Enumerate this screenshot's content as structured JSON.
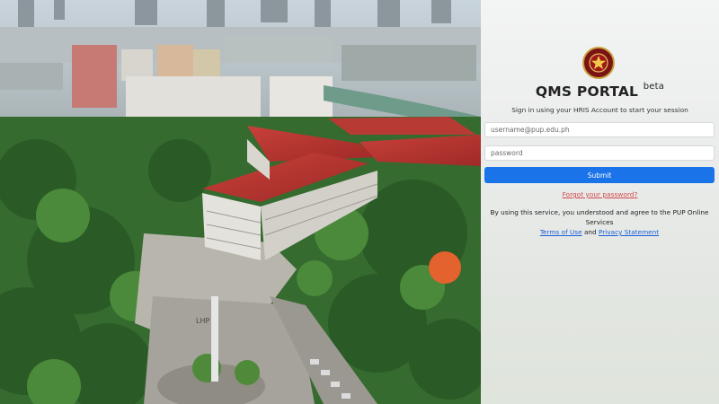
{
  "background": {
    "description_icon": "campus-aerial-photo",
    "sign_text": "LHP"
  },
  "login": {
    "logo_icon": "pup-seal-icon",
    "title": "QMS PORTAL",
    "title_superscript": "beta",
    "subtitle": "Sign in using your HRIS Account to start your session",
    "username_placeholder": "username@pup.edu.ph",
    "password_placeholder": "password",
    "submit_label": "Submit",
    "forgot_label": "Forgot your password?",
    "terms_prefix": "By using this service, you understood and agree to the PUP Online Services",
    "terms_link": "Terms of Use",
    "terms_and": "and",
    "privacy_link": "Privacy Statement"
  },
  "colors": {
    "submit_bg": "#1a73e8",
    "forgot_link": "#d24a4a",
    "link": "#1a5fd8",
    "seal_red": "#7a1414",
    "seal_gold": "#c9a441"
  }
}
